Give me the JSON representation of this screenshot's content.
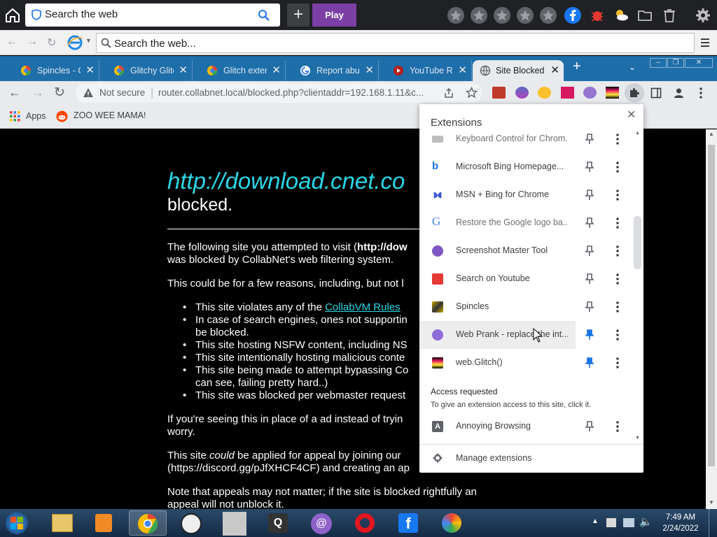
{
  "top": {
    "search_label": "Search the web",
    "play_label": "Play",
    "plus_label": "+"
  },
  "addr1": {
    "placeholder": "Search the web..."
  },
  "tabs": [
    {
      "label": "Spincles - Ch"
    },
    {
      "label": "Glitchy Glitch"
    },
    {
      "label": "Glitch extensi"
    },
    {
      "label": "Report abuse"
    },
    {
      "label": "YouTube Rec"
    },
    {
      "label": "Site Blocked"
    }
  ],
  "nav": {
    "security": "Not secure",
    "url": "router.collabnet.local/blocked.php?clientaddr=192.168.1.11&c..."
  },
  "bookmarks": {
    "apps": "Apps",
    "zoo": "ZOO WEE MAMA!"
  },
  "page": {
    "url_text": "http://download.cnet.co",
    "blocked": "blocked.",
    "p1a": "The following site you attempted to visit (",
    "p1b": "http://dow",
    "p1c": "was blocked by CollabNet's web filtering system.",
    "p2": "This could be for a few reasons, including, but not l",
    "li1a": "This site violates any of the ",
    "li1b": "CollabVM Rules",
    "li2a": "In case of search engines, ones not supportin",
    "li2b": "be blocked.",
    "li3": "This site hosting NSFW content, including NS",
    "li4": "This site intentionally hosting malicious conte",
    "li5a": "This site being made to attempt bypassing Co",
    "li5b": "can see, failing pretty hard..)",
    "li6": "This site was blocked per webmaster request",
    "p3a": "If you're seeing this in place of a ad instead of tryin",
    "p3b": "worry.",
    "p4a": "This site ",
    "p4b": "could",
    "p4c": " be applied for appeal by joining our",
    "p4d": "(https://discord.gg/pJfXHCF4CF) and creating an ap",
    "p5a": "Note that appeals may not matter; if the site is blocked rightfully an",
    "p5b": "appeal will not unblock it."
  },
  "extensions": {
    "title": "Extensions",
    "items": [
      {
        "label": "Keyboard Control for Chrom...",
        "pinned": false,
        "color": "#9e9e9e"
      },
      {
        "label": "Microsoft Bing Homepage...",
        "pinned": false,
        "color": "#1a73e8"
      },
      {
        "label": "MSN + Bing for Chrome",
        "pinned": false,
        "color": "#3b5ccc"
      },
      {
        "label": "Restore the Google logo ba...",
        "pinned": false,
        "color": "#4285f4"
      },
      {
        "label": "Screenshot Master Tool",
        "pinned": false,
        "color": "#7e57c2"
      },
      {
        "label": "Search on Youtube",
        "pinned": false,
        "color": "#e53935"
      },
      {
        "label": "Spincles",
        "pinned": false,
        "color": "#c9a400"
      },
      {
        "label": "Web Prank - replace the int...",
        "pinned": true,
        "color": "#8e6cd8"
      },
      {
        "label": "web.Glitch()",
        "pinned": true,
        "color": "#8e24aa"
      }
    ],
    "access_title": "Access requested",
    "access_desc": "To give an extension access to this site, click it.",
    "access_items": [
      {
        "label": "Annoying Browsing",
        "pinned": false,
        "color": "#5f6368"
      }
    ],
    "manage": "Manage extensions"
  },
  "tray": {
    "time": "7:49 AM",
    "date": "2/24/2022"
  }
}
